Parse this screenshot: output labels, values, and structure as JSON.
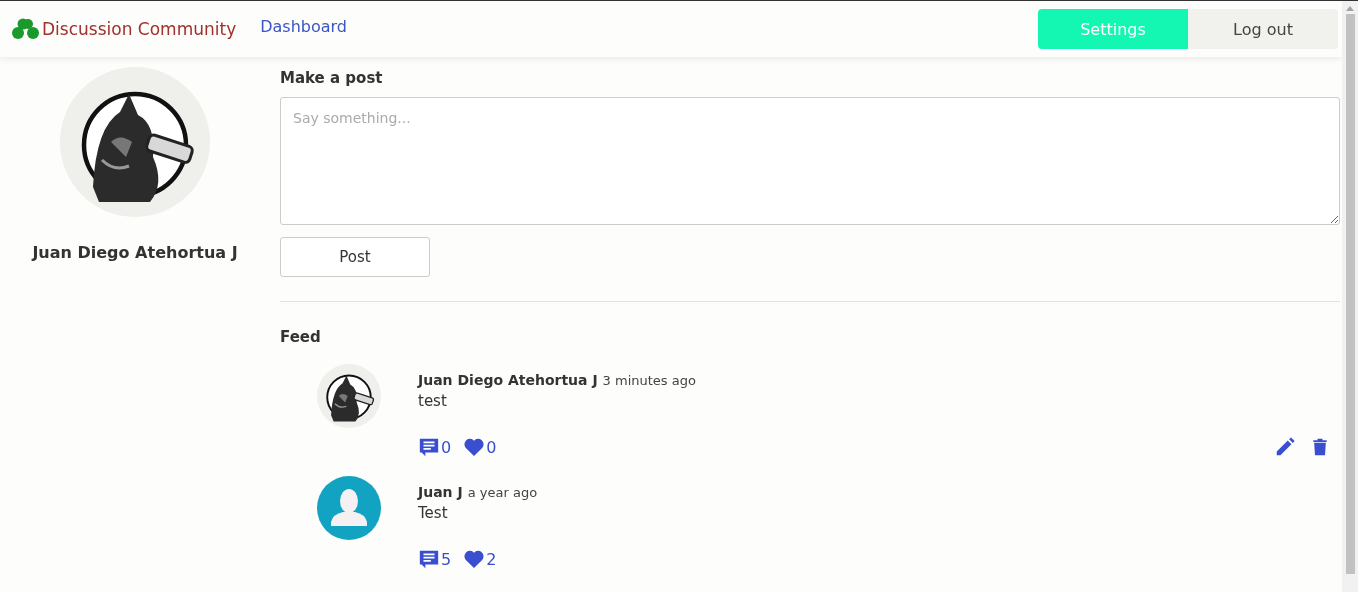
{
  "navbar": {
    "brand": "Discussion Community",
    "links": [
      {
        "label": "Dashboard"
      }
    ],
    "buttons": [
      {
        "label": "Settings",
        "selected": true
      },
      {
        "label": "Log out",
        "selected": false
      }
    ]
  },
  "profile": {
    "name": "Juan Diego Atehortua J"
  },
  "composer": {
    "title": "Make a post",
    "placeholder": "Say something...",
    "button": "Post"
  },
  "feed": {
    "title": "Feed",
    "posts": [
      {
        "author": "Juan Diego Atehortua J",
        "time": "3 minutes ago",
        "text": "test",
        "comments": "0",
        "likes": "0",
        "editable": true
      },
      {
        "avatar": {
          "kind": "default"
        },
        "author": "Juan J",
        "time": "a year ago",
        "text": "Test",
        "comments": "5",
        "likes": "2",
        "editable": false
      }
    ]
  }
}
